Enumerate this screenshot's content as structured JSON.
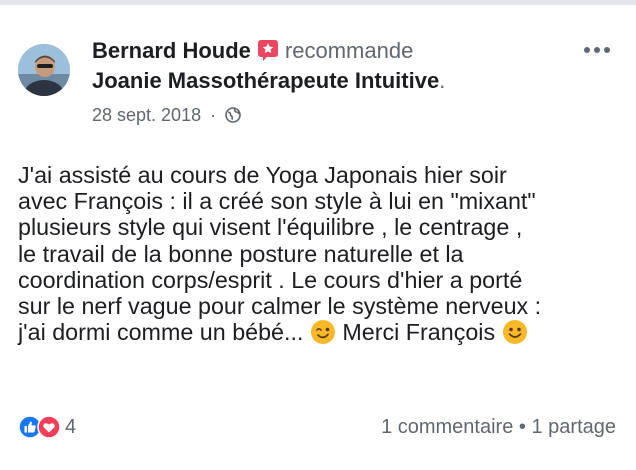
{
  "post": {
    "author": "Bernard Houde",
    "action": "recommande",
    "page_name": "Joanie Massothérapeute Intuitive",
    "page_suffix": ".",
    "date": "28 sept. 2018",
    "date_separator": "·",
    "text_lines": [
      "J'ai assisté au cours de Yoga Japonais hier soir",
      "avec François : il a créé son style à lui en \"mixant\"",
      "plusieurs style qui visent l'équilibre , le centrage ,",
      "le travail de la bonne posture naturelle et la",
      "coordination corps/esprit .  Le cours d'hier a porté",
      "sur le nerf vague pour calmer le système nerveux :"
    ],
    "last_line_part1": "j'ai dormi comme un bébé... ",
    "last_line_part2": "  Merci François "
  },
  "footer": {
    "reaction_count": "4",
    "comments": "1 commentaire",
    "separator": "•",
    "shares": "1 partage"
  },
  "icons": [
    "recommend-icon",
    "globe-icon",
    "more-options-icon",
    "wink-emoji",
    "smile-emoji",
    "like-reaction-icon",
    "love-reaction-icon"
  ],
  "colors": {
    "recommend": "#e9465f",
    "like": "#1877f2",
    "love": "#f33e58",
    "emoji": "#f7b928"
  }
}
